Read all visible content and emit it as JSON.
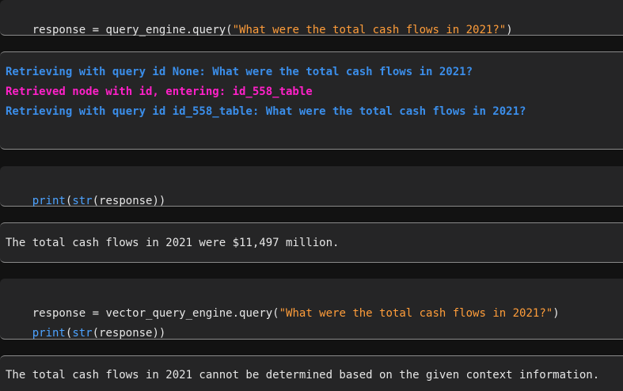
{
  "cells": [
    {
      "type": "code",
      "code": {
        "var": "response",
        "op": " = ",
        "call": "query_engine.query(",
        "arg": "\"What were the total cash flows in 2021?\"",
        "close": ")"
      }
    },
    {
      "type": "log",
      "lines": [
        "Retrieving with query id None: What were the total cash flows in 2021?",
        "Retrieved node with id, entering: id_558_table",
        "Retrieving with query id id_558_table: What were the total cash flows in 2021?"
      ]
    },
    {
      "type": "code",
      "code": {
        "print": "print",
        "open1": "(",
        "str": "str",
        "open2": "(",
        "arg": "response",
        "close": "))"
      }
    },
    {
      "type": "output",
      "text": "The total cash flows in 2021 were $11,497 million."
    },
    {
      "type": "code",
      "code": {
        "var": "response",
        "op": " = ",
        "call": "vector_query_engine.query(",
        "arg": "\"What were the total cash flows in 2021?\"",
        "close": ")",
        "print": "print",
        "open1": "(",
        "str": "str",
        "open2": "(",
        "arg2": "response",
        "close2": "))"
      }
    },
    {
      "type": "output",
      "text": "The total cash flows in 2021 cannot be determined based on the given context information."
    }
  ],
  "colors": {
    "background": "#121212",
    "cell": "#252526",
    "string": "#ff9d3a",
    "builtin": "#4da3ff",
    "log_blue": "#3b8eea",
    "log_magenta": "#ff20c8"
  }
}
